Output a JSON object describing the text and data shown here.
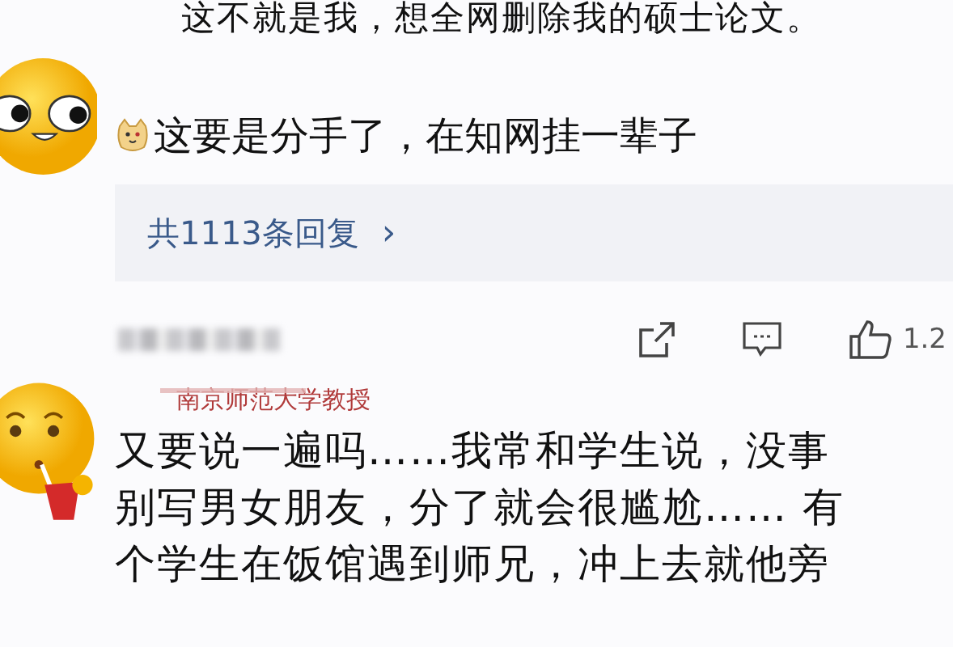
{
  "comments": [
    {
      "kind": "eyes",
      "lines": [
        "这不就是我，想全网删除我的硕士论文。"
      ],
      "reply_text": "这要是分手了，在知网挂一辈子",
      "replies_link": "共1113条回复",
      "replies_arrow": "›"
    },
    {
      "kind": "drink",
      "likes": "1.2",
      "note": "南京师范大学教授",
      "lines": [
        "又要说一遍吗……我常和学生说，没事",
        "别写男女朋友，分了就会很尴尬…… 有",
        "个学生在饭馆遇到师兄，冲上去就他旁"
      ]
    }
  ]
}
